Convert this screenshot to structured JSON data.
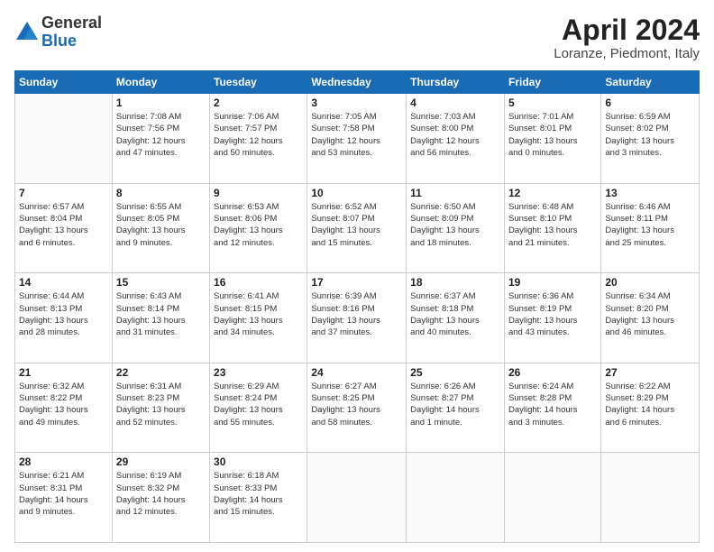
{
  "header": {
    "logo_general": "General",
    "logo_blue": "Blue",
    "month_title": "April 2024",
    "location": "Loranze, Piedmont, Italy"
  },
  "calendar": {
    "days_of_week": [
      "Sunday",
      "Monday",
      "Tuesday",
      "Wednesday",
      "Thursday",
      "Friday",
      "Saturday"
    ],
    "weeks": [
      [
        {
          "day": "",
          "info": ""
        },
        {
          "day": "1",
          "info": "Sunrise: 7:08 AM\nSunset: 7:56 PM\nDaylight: 12 hours\nand 47 minutes."
        },
        {
          "day": "2",
          "info": "Sunrise: 7:06 AM\nSunset: 7:57 PM\nDaylight: 12 hours\nand 50 minutes."
        },
        {
          "day": "3",
          "info": "Sunrise: 7:05 AM\nSunset: 7:58 PM\nDaylight: 12 hours\nand 53 minutes."
        },
        {
          "day": "4",
          "info": "Sunrise: 7:03 AM\nSunset: 8:00 PM\nDaylight: 12 hours\nand 56 minutes."
        },
        {
          "day": "5",
          "info": "Sunrise: 7:01 AM\nSunset: 8:01 PM\nDaylight: 13 hours\nand 0 minutes."
        },
        {
          "day": "6",
          "info": "Sunrise: 6:59 AM\nSunset: 8:02 PM\nDaylight: 13 hours\nand 3 minutes."
        }
      ],
      [
        {
          "day": "7",
          "info": "Sunrise: 6:57 AM\nSunset: 8:04 PM\nDaylight: 13 hours\nand 6 minutes."
        },
        {
          "day": "8",
          "info": "Sunrise: 6:55 AM\nSunset: 8:05 PM\nDaylight: 13 hours\nand 9 minutes."
        },
        {
          "day": "9",
          "info": "Sunrise: 6:53 AM\nSunset: 8:06 PM\nDaylight: 13 hours\nand 12 minutes."
        },
        {
          "day": "10",
          "info": "Sunrise: 6:52 AM\nSunset: 8:07 PM\nDaylight: 13 hours\nand 15 minutes."
        },
        {
          "day": "11",
          "info": "Sunrise: 6:50 AM\nSunset: 8:09 PM\nDaylight: 13 hours\nand 18 minutes."
        },
        {
          "day": "12",
          "info": "Sunrise: 6:48 AM\nSunset: 8:10 PM\nDaylight: 13 hours\nand 21 minutes."
        },
        {
          "day": "13",
          "info": "Sunrise: 6:46 AM\nSunset: 8:11 PM\nDaylight: 13 hours\nand 25 minutes."
        }
      ],
      [
        {
          "day": "14",
          "info": "Sunrise: 6:44 AM\nSunset: 8:13 PM\nDaylight: 13 hours\nand 28 minutes."
        },
        {
          "day": "15",
          "info": "Sunrise: 6:43 AM\nSunset: 8:14 PM\nDaylight: 13 hours\nand 31 minutes."
        },
        {
          "day": "16",
          "info": "Sunrise: 6:41 AM\nSunset: 8:15 PM\nDaylight: 13 hours\nand 34 minutes."
        },
        {
          "day": "17",
          "info": "Sunrise: 6:39 AM\nSunset: 8:16 PM\nDaylight: 13 hours\nand 37 minutes."
        },
        {
          "day": "18",
          "info": "Sunrise: 6:37 AM\nSunset: 8:18 PM\nDaylight: 13 hours\nand 40 minutes."
        },
        {
          "day": "19",
          "info": "Sunrise: 6:36 AM\nSunset: 8:19 PM\nDaylight: 13 hours\nand 43 minutes."
        },
        {
          "day": "20",
          "info": "Sunrise: 6:34 AM\nSunset: 8:20 PM\nDaylight: 13 hours\nand 46 minutes."
        }
      ],
      [
        {
          "day": "21",
          "info": "Sunrise: 6:32 AM\nSunset: 8:22 PM\nDaylight: 13 hours\nand 49 minutes."
        },
        {
          "day": "22",
          "info": "Sunrise: 6:31 AM\nSunset: 8:23 PM\nDaylight: 13 hours\nand 52 minutes."
        },
        {
          "day": "23",
          "info": "Sunrise: 6:29 AM\nSunset: 8:24 PM\nDaylight: 13 hours\nand 55 minutes."
        },
        {
          "day": "24",
          "info": "Sunrise: 6:27 AM\nSunset: 8:25 PM\nDaylight: 13 hours\nand 58 minutes."
        },
        {
          "day": "25",
          "info": "Sunrise: 6:26 AM\nSunset: 8:27 PM\nDaylight: 14 hours\nand 1 minute."
        },
        {
          "day": "26",
          "info": "Sunrise: 6:24 AM\nSunset: 8:28 PM\nDaylight: 14 hours\nand 3 minutes."
        },
        {
          "day": "27",
          "info": "Sunrise: 6:22 AM\nSunset: 8:29 PM\nDaylight: 14 hours\nand 6 minutes."
        }
      ],
      [
        {
          "day": "28",
          "info": "Sunrise: 6:21 AM\nSunset: 8:31 PM\nDaylight: 14 hours\nand 9 minutes."
        },
        {
          "day": "29",
          "info": "Sunrise: 6:19 AM\nSunset: 8:32 PM\nDaylight: 14 hours\nand 12 minutes."
        },
        {
          "day": "30",
          "info": "Sunrise: 6:18 AM\nSunset: 8:33 PM\nDaylight: 14 hours\nand 15 minutes."
        },
        {
          "day": "",
          "info": ""
        },
        {
          "day": "",
          "info": ""
        },
        {
          "day": "",
          "info": ""
        },
        {
          "day": "",
          "info": ""
        }
      ]
    ]
  }
}
